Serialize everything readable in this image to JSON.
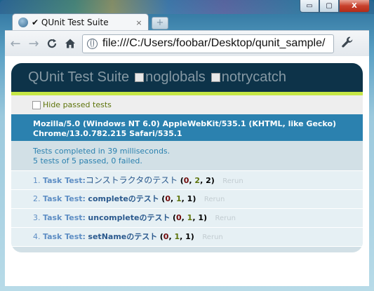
{
  "window": {
    "controls": {
      "minimize": "▭",
      "maximize": "▢",
      "close": "X"
    }
  },
  "tab": {
    "title": "✔ QUnit Test Suite",
    "close": "×",
    "new_tab": "+"
  },
  "toolbar": {
    "url": "file:///C:/Users/foobar/Desktop/qunit_sample/",
    "back": "←",
    "forward": "→",
    "reload": "C",
    "home": "⌂",
    "wrench": "🔧"
  },
  "qunit": {
    "title": "QUnit Test Suite",
    "options": [
      "noglobals",
      "notrycatch"
    ],
    "hide_passed": "Hide passed tests",
    "useragent": "Mozilla/5.0 (Windows NT 6.0) AppleWebKit/535.1 (KHTML, like Gecko) Chrome/13.0.782.215 Safari/535.1",
    "result_line1": "Tests completed in 39 milliseconds.",
    "result_line2": "5 tests of 5 passed, 0 failed.",
    "tests": [
      {
        "num": "1.",
        "module": "Task Test:",
        "name": "コンストラクタのテスト",
        "failed": "0",
        "passed": "2",
        "total": "2",
        "rerun": "Rerun"
      },
      {
        "num": "2.",
        "module": "Task Test:",
        "name": "completeのテスト",
        "failed": "0",
        "passed": "1",
        "total": "1",
        "rerun": "Rerun"
      },
      {
        "num": "3.",
        "module": "Task Test:",
        "name": "uncompleteのテスト",
        "failed": "0",
        "passed": "1",
        "total": "1",
        "rerun": "Rerun"
      },
      {
        "num": "4.",
        "module": "Task Test:",
        "name": "setNameのテスト",
        "failed": "0",
        "passed": "1",
        "total": "1",
        "rerun": "Rerun"
      }
    ]
  },
  "colors": {
    "header": "#0d3349",
    "banner_pass": "#c6e746",
    "useragent": "#2b81af",
    "result_bg": "#d2e0e6"
  }
}
